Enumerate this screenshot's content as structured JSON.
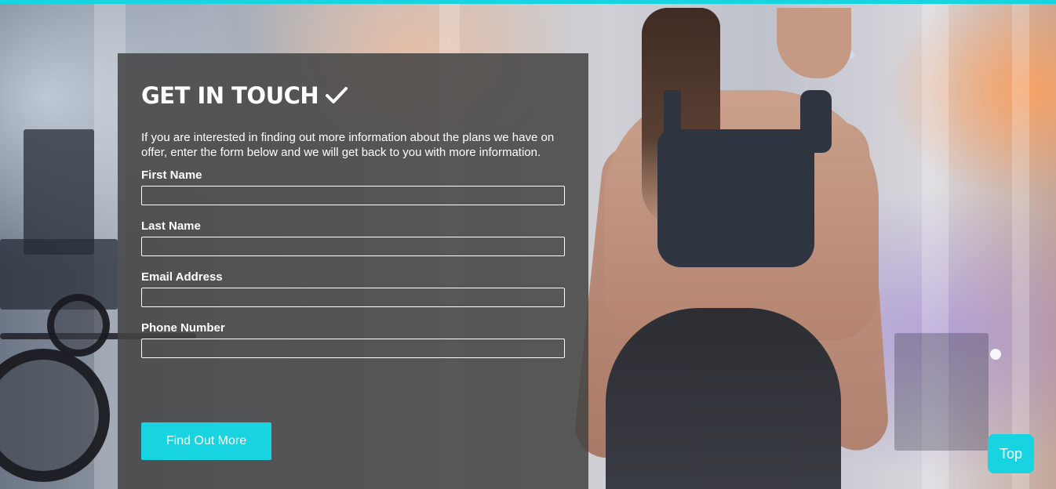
{
  "colors": {
    "accent": "#17d4e0",
    "panel_background": "#444444",
    "text": "#ffffff"
  },
  "contact_form": {
    "title": "GET IN TOUCH",
    "title_icon": "checkmark-icon",
    "intro": "If you are interested in finding out more information about the plans we have on offer, enter the form below and we will get back to you with more information.",
    "fields": [
      {
        "label": "First Name",
        "value": "",
        "placeholder": ""
      },
      {
        "label": "Last Name",
        "value": "",
        "placeholder": ""
      },
      {
        "label": "Email Address",
        "value": "",
        "placeholder": ""
      },
      {
        "label": "Phone Number",
        "value": "",
        "placeholder": ""
      }
    ],
    "submit_label": "Find Out More"
  },
  "scroll_top": {
    "label": "Top"
  },
  "background_image": "gym-photo-woman-in-sportswear"
}
